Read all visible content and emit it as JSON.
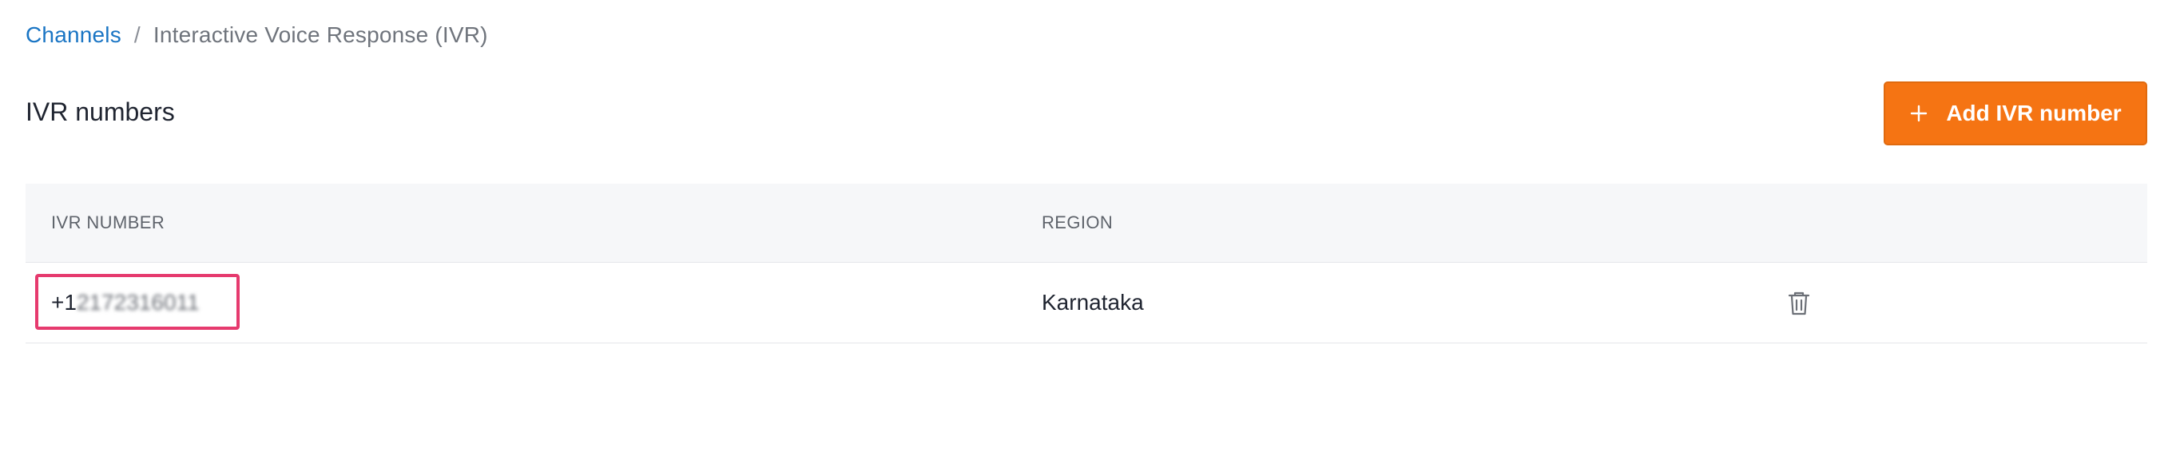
{
  "breadcrumb": {
    "parent": "Channels",
    "separator": "/",
    "current": "Interactive Voice Response (IVR)"
  },
  "page": {
    "title": "IVR numbers"
  },
  "actions": {
    "add_label": "Add IVR number",
    "add_icon": "plus-icon",
    "accent_color": "#f57413"
  },
  "table": {
    "columns": [
      "IVR NUMBER",
      "REGION"
    ],
    "rows": [
      {
        "number_prefix": "+1",
        "number_masked": "2172316011",
        "region": "Karnataka",
        "action_icon": "trash-icon"
      }
    ]
  },
  "highlight_color": "#e63a6e"
}
